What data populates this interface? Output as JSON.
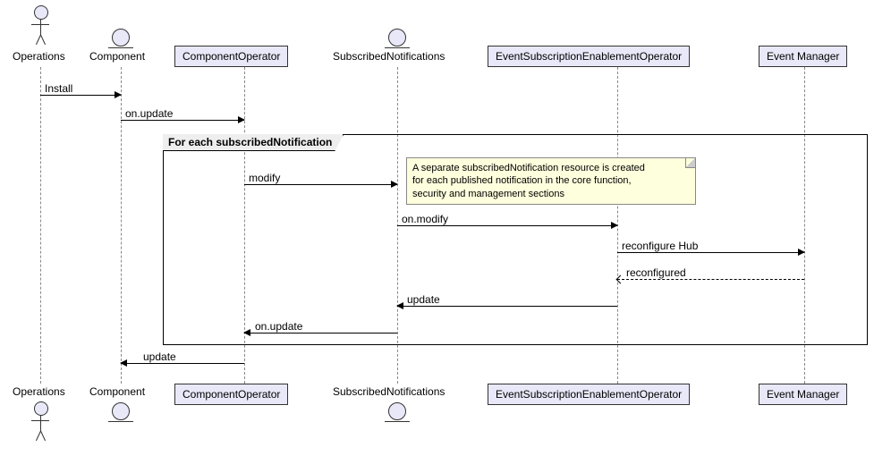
{
  "participants": {
    "operations": "Operations",
    "component": "Component",
    "componentOperator": "ComponentOperator",
    "subscribedNotifications": "SubscribedNotifications",
    "eseOperator": "EventSubscriptionEnablementOperator",
    "eventManager": "Event Manager"
  },
  "loop": {
    "title": "For each subscribedNotification"
  },
  "note": {
    "line1": "A separate subscribedNotification resource is created",
    "line2": "for each published notification in the core function,",
    "line3": "security and management sections"
  },
  "messages": {
    "install": "Install",
    "onUpdate1": "on.update",
    "modify": "modify",
    "onModify": "on.modify",
    "reconfigureHub": "reconfigure Hub",
    "reconfigured": "reconfigured",
    "updateSN": "update",
    "onUpdate2": "on.update",
    "updateComp": "update"
  },
  "chart_data": {
    "type": "sequence",
    "participants": [
      {
        "id": "operations",
        "kind": "actor",
        "label": "Operations"
      },
      {
        "id": "component",
        "kind": "entity",
        "label": "Component"
      },
      {
        "id": "componentOperator",
        "kind": "participant",
        "label": "ComponentOperator"
      },
      {
        "id": "subscribedNotifications",
        "kind": "entity",
        "label": "SubscribedNotifications"
      },
      {
        "id": "eseOperator",
        "kind": "participant",
        "label": "EventSubscriptionEnablementOperator"
      },
      {
        "id": "eventManager",
        "kind": "participant",
        "label": "Event Manager"
      }
    ],
    "fragments": [
      {
        "type": "loop",
        "label": "For each subscribedNotification",
        "covers": [
          "componentOperator",
          "subscribedNotifications",
          "eseOperator",
          "eventManager"
        ]
      }
    ],
    "messages": [
      {
        "from": "operations",
        "to": "component",
        "label": "Install",
        "style": "sync"
      },
      {
        "from": "component",
        "to": "componentOperator",
        "label": "on.update",
        "style": "sync"
      },
      {
        "from": "componentOperator",
        "to": "subscribedNotifications",
        "label": "modify",
        "style": "sync",
        "in_loop": true,
        "note": "A separate subscribedNotification resource is created for each published notification in the core function, security and management sections"
      },
      {
        "from": "subscribedNotifications",
        "to": "eseOperator",
        "label": "on.modify",
        "style": "sync",
        "in_loop": true
      },
      {
        "from": "eseOperator",
        "to": "eventManager",
        "label": "reconfigure Hub",
        "style": "sync",
        "in_loop": true
      },
      {
        "from": "eventManager",
        "to": "eseOperator",
        "label": "reconfigured",
        "style": "return",
        "in_loop": true
      },
      {
        "from": "eseOperator",
        "to": "subscribedNotifications",
        "label": "update",
        "style": "sync",
        "in_loop": true
      },
      {
        "from": "subscribedNotifications",
        "to": "componentOperator",
        "label": "on.update",
        "style": "sync",
        "in_loop": true
      },
      {
        "from": "componentOperator",
        "to": "component",
        "label": "update",
        "style": "sync"
      }
    ]
  }
}
